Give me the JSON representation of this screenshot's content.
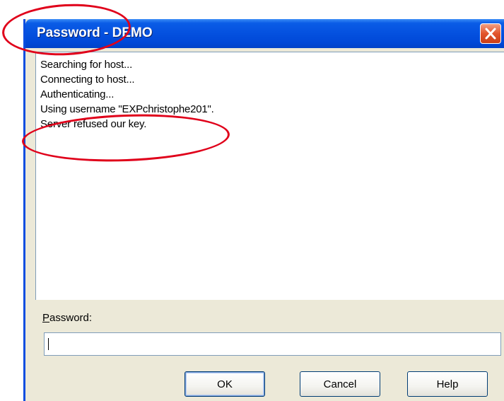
{
  "window": {
    "title": "Password - DEMO",
    "close_icon": "close-icon"
  },
  "log": {
    "lines": [
      "Searching for host...",
      "Connecting to host...",
      "Authenticating...",
      "Using username \"EXPchristophe201\".",
      "Server refused our key."
    ]
  },
  "password": {
    "label_prefix": "P",
    "label_rest": "assword:",
    "value": ""
  },
  "buttons": {
    "ok": "OK",
    "cancel": "Cancel",
    "help": "Help"
  },
  "colors": {
    "titlebar": "#0552e0",
    "close_button": "#e2542c",
    "dialog_face": "#ece9d8",
    "annotation": "#e0001a"
  }
}
